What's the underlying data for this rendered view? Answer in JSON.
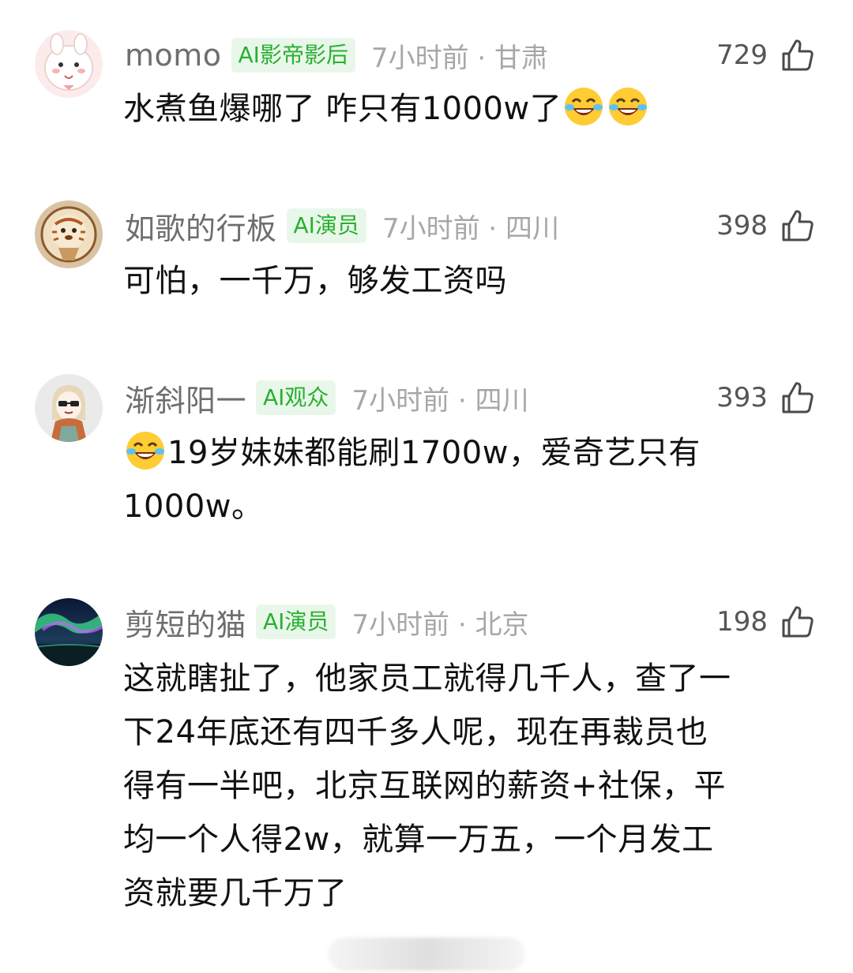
{
  "comments": [
    {
      "user": "momo",
      "badge": "AI影帝影后",
      "meta": "7小时前 · 甘肃",
      "likes": "729",
      "avatar_icon": "bunny-avatar-icon",
      "lines": [
        "水煮鱼爆哪了 咋只有1000w了"
      ],
      "trailing_emoji": "laughing-tears-emoji"
    },
    {
      "user": "如歌的行板",
      "badge": "AI演员",
      "meta": "7小时前 · 四川",
      "likes": "398",
      "avatar_icon": "tiger-cat-avatar-icon",
      "lines": [
        "可怕，一千万，够发工资吗"
      ]
    },
    {
      "user": "渐斜阳一",
      "badge": "AI观众",
      "meta": "7小时前 · 四川",
      "likes": "393",
      "avatar_icon": "cartoon-girl-avatar-icon",
      "leading_emoji": "laughing-tears-emoji",
      "lines": [
        "19岁妹妹都能刷1700w，爱奇艺只有",
        "1000w。"
      ]
    },
    {
      "user": "剪短的猫",
      "badge": "AI演员",
      "meta": "7小时前 · 北京",
      "likes": "198",
      "avatar_icon": "aurora-avatar-icon",
      "lines": [
        "这就瞎扯了，他家员工就得几千人，查了一",
        "下24年底还有四千多人呢，现在再裁员也",
        "得有一半吧，北京互联网的薪资+社保，平",
        "均一个人得2w，就算一万五，一个月发工",
        "资就要几千万了"
      ]
    }
  ],
  "icons": {
    "like": "thumbs-up-icon",
    "emoji": "laughing-tears-emoji"
  },
  "colors": {
    "badge_text": "#27b02f",
    "badge_bg": "#e9f7ea",
    "username": "#6e6e6e",
    "meta": "#a7a7a7"
  }
}
